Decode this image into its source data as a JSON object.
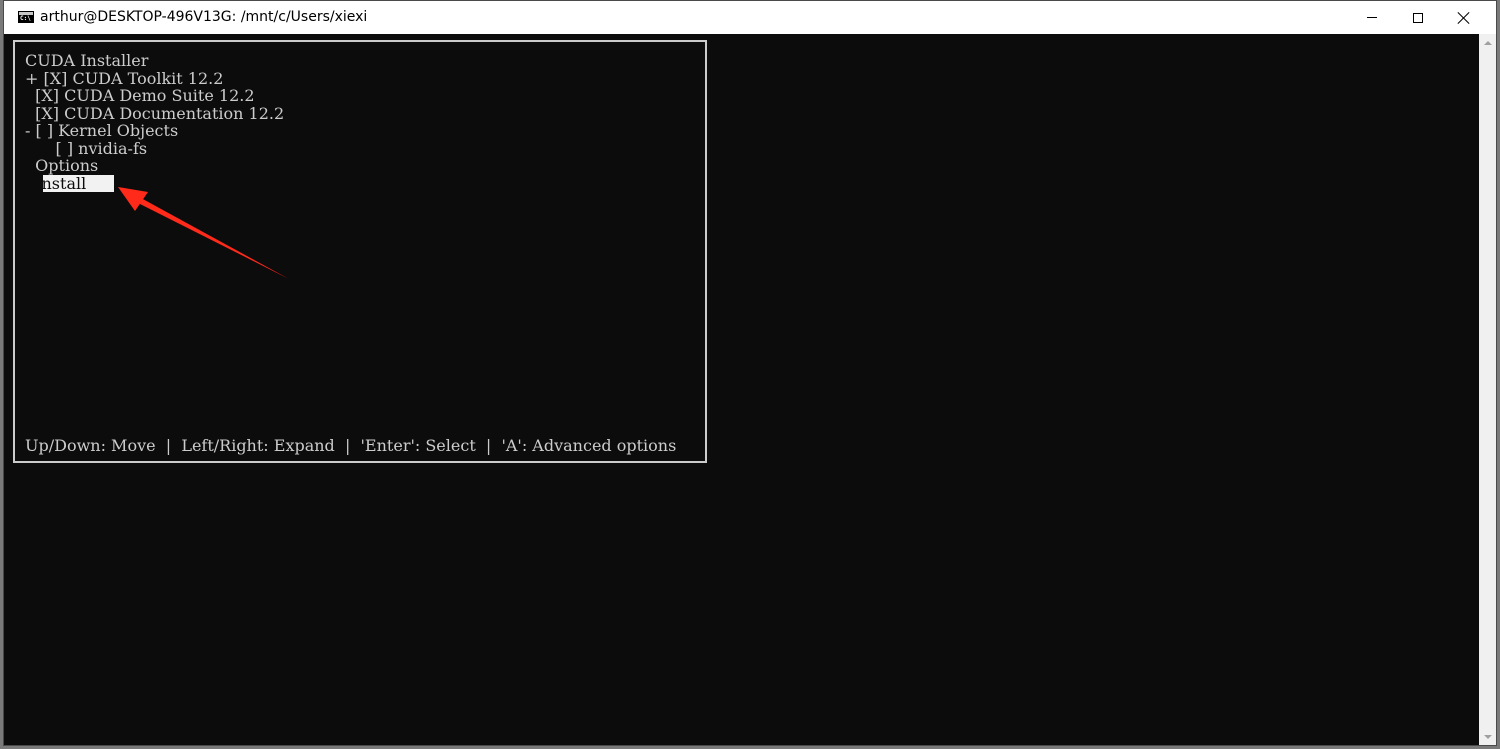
{
  "window": {
    "title": "arthur@DESKTOP-496V13G: /mnt/c/Users/xiexi",
    "icon": "terminal-icon",
    "controls": [
      "minimize-icon",
      "maximize-icon",
      "close-icon"
    ]
  },
  "installer": {
    "title": "CUDA Installer",
    "items": [
      {
        "text": "+ [X] CUDA Toolkit 12.2"
      },
      {
        "text": "  [X] CUDA Demo Suite 12.2"
      },
      {
        "text": "  [X] CUDA Documentation 12.2"
      },
      {
        "text": "- [ ] Kernel Objects"
      },
      {
        "text": "      [ ] nvidia-fs"
      },
      {
        "text": "  Options"
      },
      {
        "text": "  Install",
        "selected": true
      }
    ],
    "hints": "Up/Down: Move  |  Left/Right: Expand  |  'Enter': Select  |  'A': Advanced options"
  },
  "colors": {
    "terminal_bg": "#0c0c0c",
    "terminal_fg": "#cccccc",
    "selection_bg": "#f2f2f2",
    "annotation_arrow": "#ff2a1a"
  }
}
